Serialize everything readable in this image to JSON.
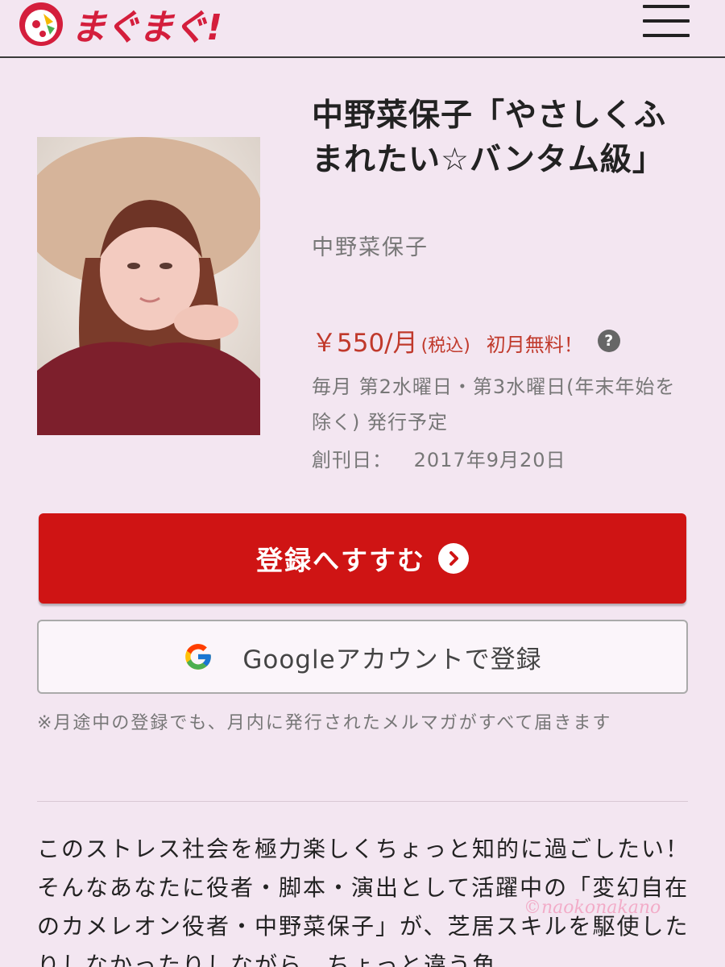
{
  "header": {
    "logo_text": "まぐまぐ!",
    "menu_icon": "hamburger-menu-icon"
  },
  "product": {
    "title": "中野菜保子「やさしくふまれたい☆バンタム級」",
    "author": "中野菜保子",
    "photo_icon": "author-photo",
    "price": "￥550/月",
    "tax_note": "(税込)",
    "free_offer": "初月無料！",
    "help_icon": "question-circle-icon",
    "help_glyph": "?",
    "schedule": "毎月 第2水曜日・第3水曜日(年末年始を除く) 発行予定",
    "start_label": "創刊日：",
    "start_date": "2017年9月20日"
  },
  "actions": {
    "register_label": "登録へすすむ",
    "register_icon": "chevron-right-circle-icon",
    "google_label": "Googleアカウントで登録",
    "google_icon": "google-g-icon"
  },
  "note": "※月途中の登録でも、月内に発行されたメルマガがすべて届きます",
  "description": "このストレス社会を極力楽しくちょっと知的に過ごしたい！そんなあなたに役者・脚本・演出として活躍中の「変幻自在のカメレオン役者・中野菜保子」が、芝居スキルを駆使したりしなかったりしながら、ちょっと違う角",
  "watermark": "©naokonakano",
  "colors": {
    "background": "#f3e6f1",
    "accent": "#cf1414",
    "price": "#c0392b",
    "logo": "#d41e3c"
  }
}
